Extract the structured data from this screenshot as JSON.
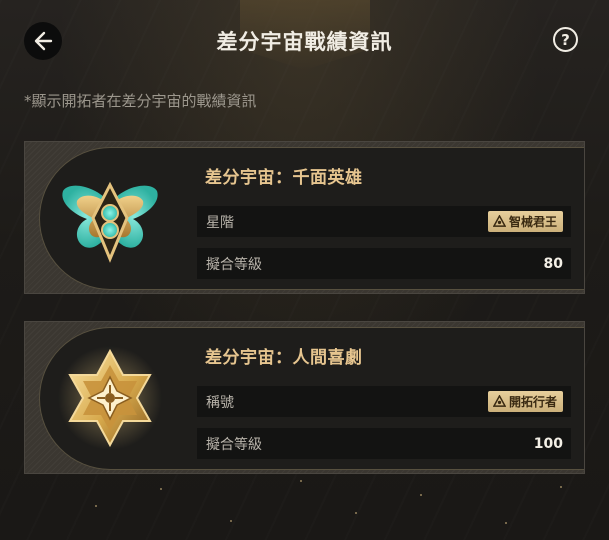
{
  "header": {
    "title": "差分宇宙戰績資訊",
    "back_icon": "back-arrow-icon",
    "help_label": "?",
    "help_icon": "help-circle-icon"
  },
  "subtitle": "*顯示開拓者在差分宇宙的戰績資訊",
  "cards": [
    {
      "title": "差分宇宙：千面英雄",
      "emblem": "butterfly-emblem-icon",
      "rows": [
        {
          "label": "星階",
          "badge": "智械君王",
          "badge_icon": "rank-triangle-icon"
        },
        {
          "label": "擬合等級",
          "value": "80"
        }
      ]
    },
    {
      "title": "差分宇宙：人間喜劇",
      "emblem": "star-emblem-icon",
      "rows": [
        {
          "label": "稱號",
          "badge": "開拓行者",
          "badge_icon": "rank-triangle-icon"
        },
        {
          "label": "擬合等級",
          "value": "100"
        }
      ]
    }
  ],
  "colors": {
    "background": "#1d1b18",
    "card_title": "#e6c58f",
    "badge": "#dcc28c",
    "accent_teal": "#5fe3d2",
    "accent_gold": "#d7a94c"
  }
}
